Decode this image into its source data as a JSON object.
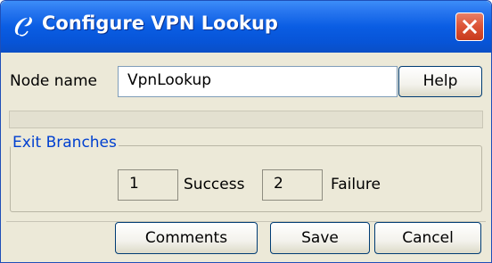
{
  "window": {
    "title": "Configure VPN Lookup"
  },
  "node": {
    "label": "Node name",
    "value": "VpnLookup"
  },
  "buttons": {
    "help": "Help",
    "comments": "Comments",
    "save": "Save",
    "cancel": "Cancel"
  },
  "exit_branches": {
    "legend": "Exit Branches",
    "items": [
      {
        "number": "1",
        "label": "Success"
      },
      {
        "number": "2",
        "label": "Failure"
      }
    ]
  },
  "icons": {
    "title": "script-icon",
    "close": "close-icon"
  },
  "colors": {
    "titlebar": "#0754d7",
    "close": "#dd5638",
    "legend": "#0040d0",
    "window_bg": "#ece9d8"
  }
}
